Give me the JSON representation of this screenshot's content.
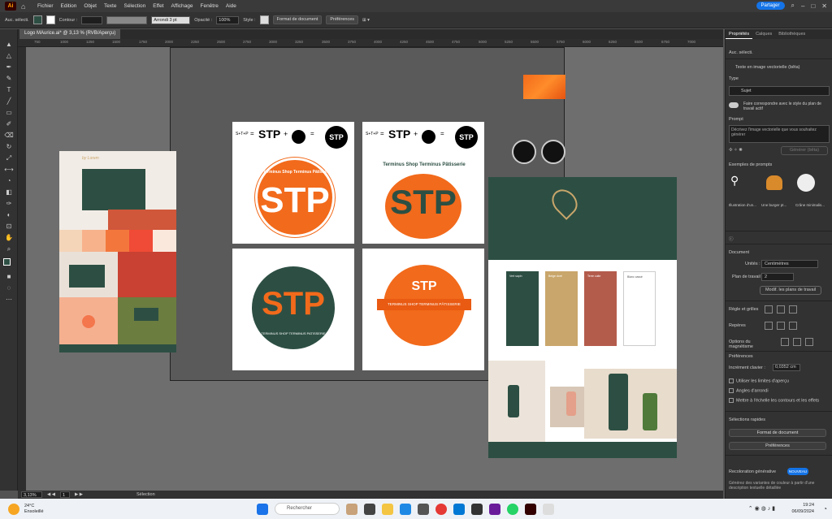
{
  "menubar": {
    "logo": "Ai",
    "items": [
      "Fichier",
      "Edition",
      "Objet",
      "Texte",
      "Sélection",
      "Effet",
      "Affichage",
      "Fenêtre",
      "Aide"
    ],
    "share_label": "Partager"
  },
  "control_bar": {
    "selection_label": "Auc. sélecti.",
    "stroke_label": "Contour :",
    "brush_label": "Arrondi 3 pt",
    "opacity_label": "Opacité :",
    "opacity_value": "100%",
    "style_label": "Style :",
    "doc_format_button": "Format de document",
    "prefs_button": "Préférences"
  },
  "document_tab": {
    "title": "Logo MAurice.ai* @ 3,13 % (RVB/Aperçu)"
  },
  "ruler_ticks": [
    "750",
    "1000",
    "1250",
    "1500",
    "1750",
    "2000",
    "2250",
    "2500",
    "2750",
    "3000",
    "3250",
    "3500",
    "3750",
    "4000",
    "4250",
    "4500",
    "4750",
    "5000",
    "5250",
    "5500",
    "5750",
    "6000",
    "6250",
    "6500",
    "6750",
    "7000"
  ],
  "artwork": {
    "formula_left": "S+T+P",
    "stp": "STP",
    "plus": "+",
    "equals": "=",
    "badge_circle_text": "Terminus Shop Terminus Pâtisserie",
    "badge_green_text": "TERMINUS SHOP TERMINUS PATISSERIE",
    "badge_ribbon_text": "TERMINUS SHOP TERMINUS PÂTISSERIE",
    "moodboard_brand": "by Lorem",
    "brand_cards": [
      "Vert sapin",
      "Beige doré",
      "Terre cuite",
      "Blanc cassé"
    ]
  },
  "status_bar": {
    "zoom": "3,13%",
    "page": "1",
    "mode": "Sélection"
  },
  "right_panel": {
    "tabs": [
      "Propriétés",
      "Calques",
      "Bibliothèques"
    ],
    "no_selection": "Auc. sélecti.",
    "section_title": "Texte en image vectorielle (bêta)",
    "type_label": "Type",
    "type_value": "Sujet",
    "toggle_label": "Faire correspondre avec le style du plan de travail actif",
    "prompt_label": "Prompt",
    "prompt_placeholder": "Décrivez l'image vectorielle que vous souhaitez générer",
    "generate_button": "Générer (bêta)",
    "examples_label": "Exemples de prompts",
    "examples": [
      "Illustration d'un...",
      "Une burger pt...",
      "Crâne minimalis..."
    ],
    "document_label": "Document",
    "units_label": "Unités :",
    "units_value": "Centimètres",
    "artboard_label": "Plan de travail :",
    "artboard_value": "2",
    "edit_artboards_button": "Modif. les plans de travail",
    "rulers_label": "Règle et grilles",
    "guides_label": "Repères",
    "snap_label": "Options du magnétisme",
    "prefs_label": "Préférences",
    "keyboard_increment_label": "Incrément clavier :",
    "keyboard_increment_value": "0,0352 cm",
    "checkboxes": [
      "Utiliser les limites d'aperçu",
      "Angles d'arrondi",
      "Mettre à l'échelle les contours et les effets"
    ],
    "quick_actions_label": "Sélections rapides",
    "doc_format_button": "Format de document",
    "prefs_button": "Préférences",
    "genai_label": "Recoloration générative",
    "genai_badge": "NOUVEAU",
    "genai_desc": "Générez des variantes de couleur à partir d'une description textuelle détaillée"
  },
  "taskbar": {
    "temperature": "24°C",
    "weather": "Ensoleillé",
    "search_placeholder": "Rechercher",
    "time": "19:24",
    "date": "06/09/2024"
  },
  "colors": {
    "orange": "#f26a1b",
    "green": "#2d4f43",
    "gold": "#c9a66b",
    "terracotta": "#b45c4c"
  }
}
